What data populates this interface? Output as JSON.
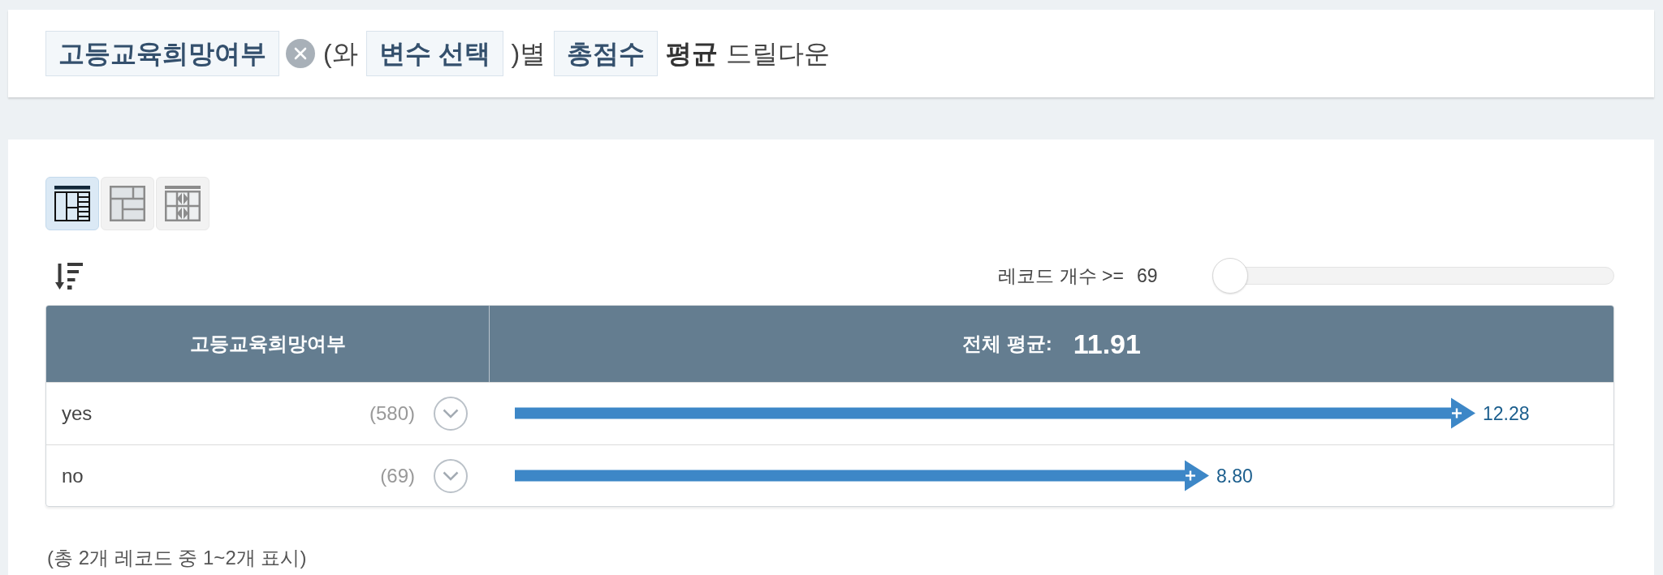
{
  "query_bar": {
    "parts": [
      {
        "kind": "tag",
        "text": "고등교육희망여부",
        "removable": true
      },
      {
        "kind": "text",
        "text": "(와"
      },
      {
        "kind": "tag",
        "text": "변수 선택",
        "removable": false
      },
      {
        "kind": "text",
        "text": ")별"
      },
      {
        "kind": "tag",
        "text": "총점수",
        "removable": false
      },
      {
        "kind": "bold",
        "text": "평균"
      },
      {
        "kind": "text",
        "text": "드릴다운"
      }
    ]
  },
  "view_modes": [
    {
      "kind": "table",
      "selected": true
    },
    {
      "kind": "blocks",
      "selected": false
    },
    {
      "kind": "split",
      "selected": false
    }
  ],
  "record_filter": {
    "label": "레코드 개수 >=",
    "value": "69",
    "level": 0
  },
  "table": {
    "group_column": "고등교육희망여부",
    "average_label": "전체 평균:",
    "average_value": "11.91",
    "rows": [
      {
        "count": "(580)"
      },
      {
        "count": "(69)"
      }
    ],
    "chart_data": {
      "type": "bar",
      "orientation": "horizontal",
      "categories": [
        "yes",
        "no"
      ],
      "values": [
        12.28,
        8.8
      ],
      "value_labels": [
        "12.28",
        "8.80"
      ]
    }
  },
  "footer": "(총 2개 레코드 중 1~2개 표시)"
}
